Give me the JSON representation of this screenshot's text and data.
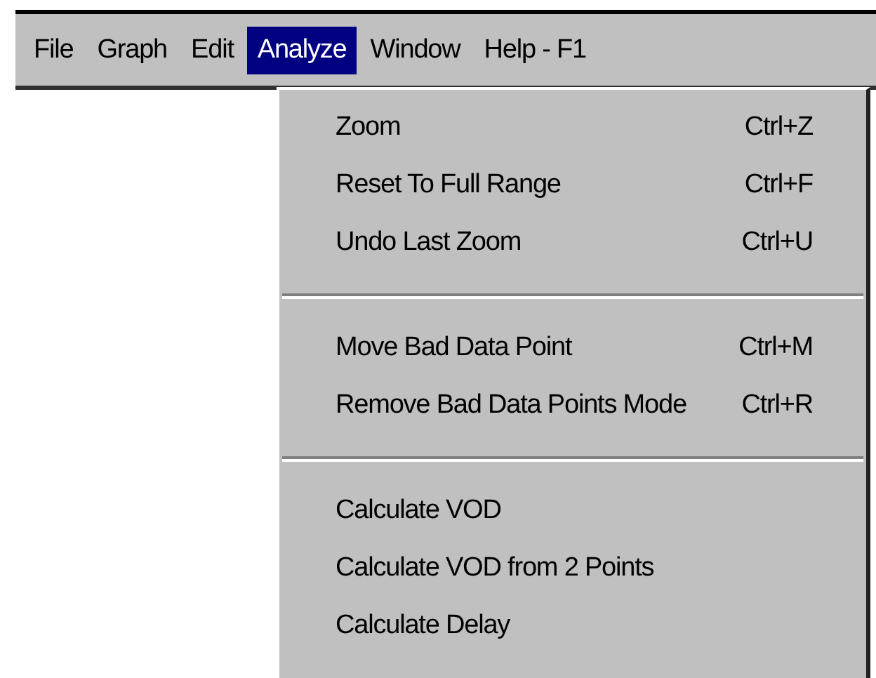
{
  "menu_bar": [
    {
      "label": "File",
      "selected": false
    },
    {
      "label": "Graph",
      "selected": false
    },
    {
      "label": "Edit",
      "selected": false
    },
    {
      "label": "Analyze",
      "selected": true
    },
    {
      "label": "Window",
      "selected": false
    },
    {
      "label": "Help - F1",
      "selected": false
    }
  ],
  "menu": {
    "groups": [
      [
        {
          "label": "Zoom",
          "shortcut": "Ctrl+Z"
        },
        {
          "label": "Reset To Full Range",
          "shortcut": "Ctrl+F"
        },
        {
          "label": "Undo Last Zoom",
          "shortcut": "Ctrl+U"
        }
      ],
      [
        {
          "label": "Move Bad Data Point",
          "shortcut": "Ctrl+M"
        },
        {
          "label": "Remove Bad Data Points Mode",
          "shortcut": "Ctrl+R"
        }
      ],
      [
        {
          "label": "Calculate VOD"
        },
        {
          "label": "Calculate VOD from 2 Points"
        },
        {
          "label": "Calculate Delay"
        }
      ]
    ]
  }
}
